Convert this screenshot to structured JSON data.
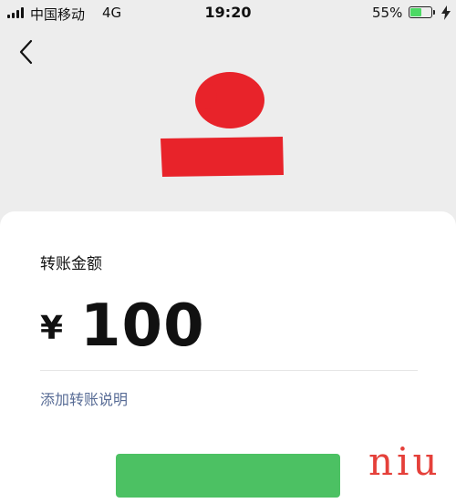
{
  "status_bar": {
    "carrier": "中国移动",
    "network": "4G",
    "time": "19:20",
    "battery_percent": "55%",
    "battery_level": 0.55,
    "battery_color": "#4cd964"
  },
  "nav": {
    "back_icon": "chevron-left-icon"
  },
  "payee": {
    "avatar_redacted_color": "#e8232a",
    "name_redacted_color": "#e8232a"
  },
  "transfer": {
    "amount_label": "转账金额",
    "currency_symbol": "¥",
    "amount": "100",
    "add_note_label": "添加转账说明",
    "link_color": "#576b95",
    "button_color": "#4cc163"
  },
  "watermark": {
    "text": "niu"
  }
}
